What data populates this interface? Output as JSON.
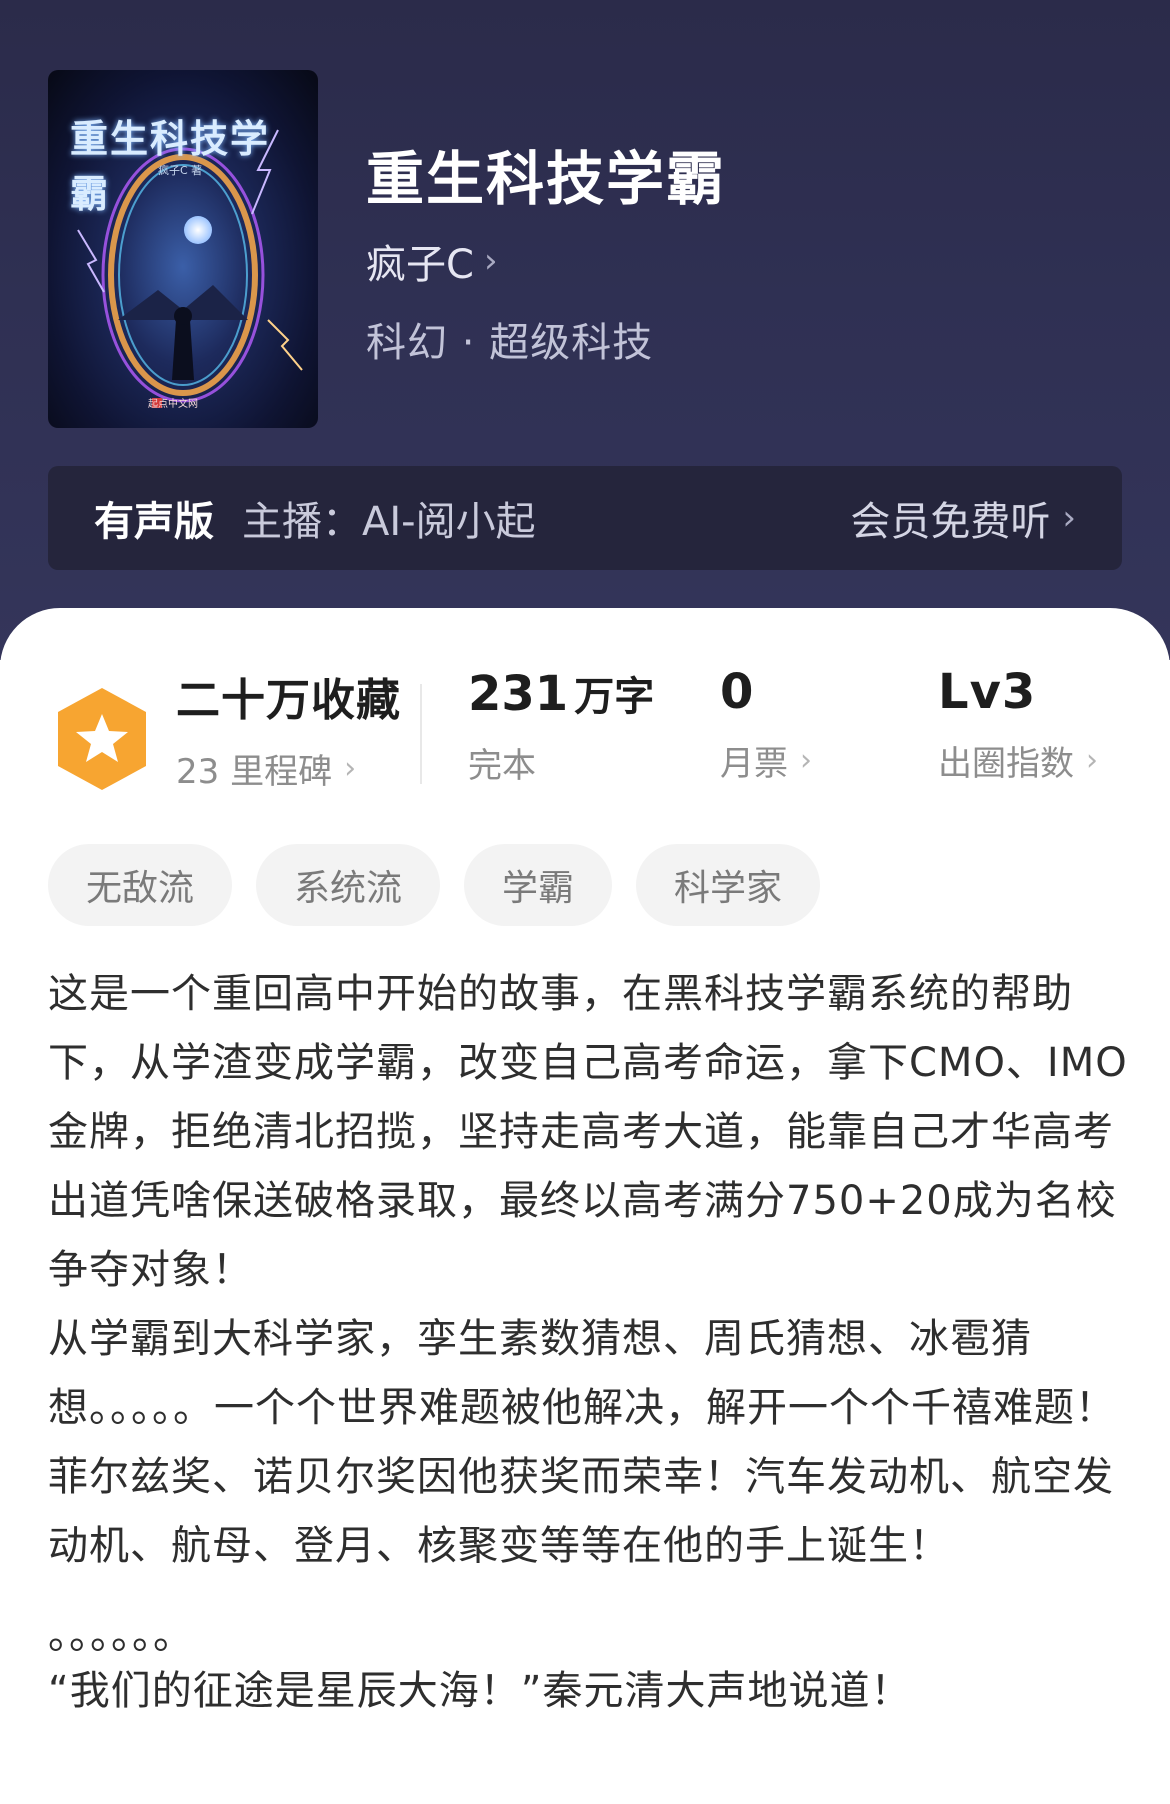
{
  "book": {
    "cover_title": "重生科技学霸",
    "cover_author": "疯子C 著",
    "cover_publisher": "起点中文网",
    "title": "重生科技学霸",
    "author": "疯子C",
    "genre": "科幻 · 超级科技"
  },
  "audio": {
    "label": "有声版",
    "host": "主播：AI-阅小起",
    "link": "会员免费听"
  },
  "stats": {
    "favorites": "二十万收藏",
    "milestones": "23 里程碑",
    "words_number": "231",
    "words_unit": "万字",
    "status": "完本",
    "monthly_votes": "0",
    "monthly_votes_label": "月票",
    "level": "Lv3",
    "level_label": "出圈指数"
  },
  "tags": [
    "无敌流",
    "系统流",
    "学霸",
    "科学家"
  ],
  "description": {
    "p1": "这是一个重回高中开始的故事，在黑科技学霸系统的帮助下，从学渣变成学霸，改变自己高考命运，拿下CMO、IMO金牌，拒绝清北招揽，坚持走高考大道，能靠自己才华高考出道凭啥保送破格录取，最终以高考满分750+20成为名校争夺对象！",
    "p2": "从学霸到大科学家，孪生素数猜想、周氏猜想、冰雹猜想。。。。。一个个世界难题被他解决，解开一个个千禧难题！菲尔兹奖、诺贝尔奖因他获奖而荣幸！汽车发动机、航空发动机、航母、登月、核聚变等等在他的手上诞生！",
    "p3": "。。。。。。",
    "p4": "“我们的征途是星辰大海！”秦元清大声地说道！"
  },
  "colors": {
    "header_bg": "#2f3053",
    "badge_orange": "#f7a531",
    "tag_bg": "#f3f3f3"
  },
  "icons": [
    "chevron-right-icon",
    "star-badge-icon"
  ]
}
